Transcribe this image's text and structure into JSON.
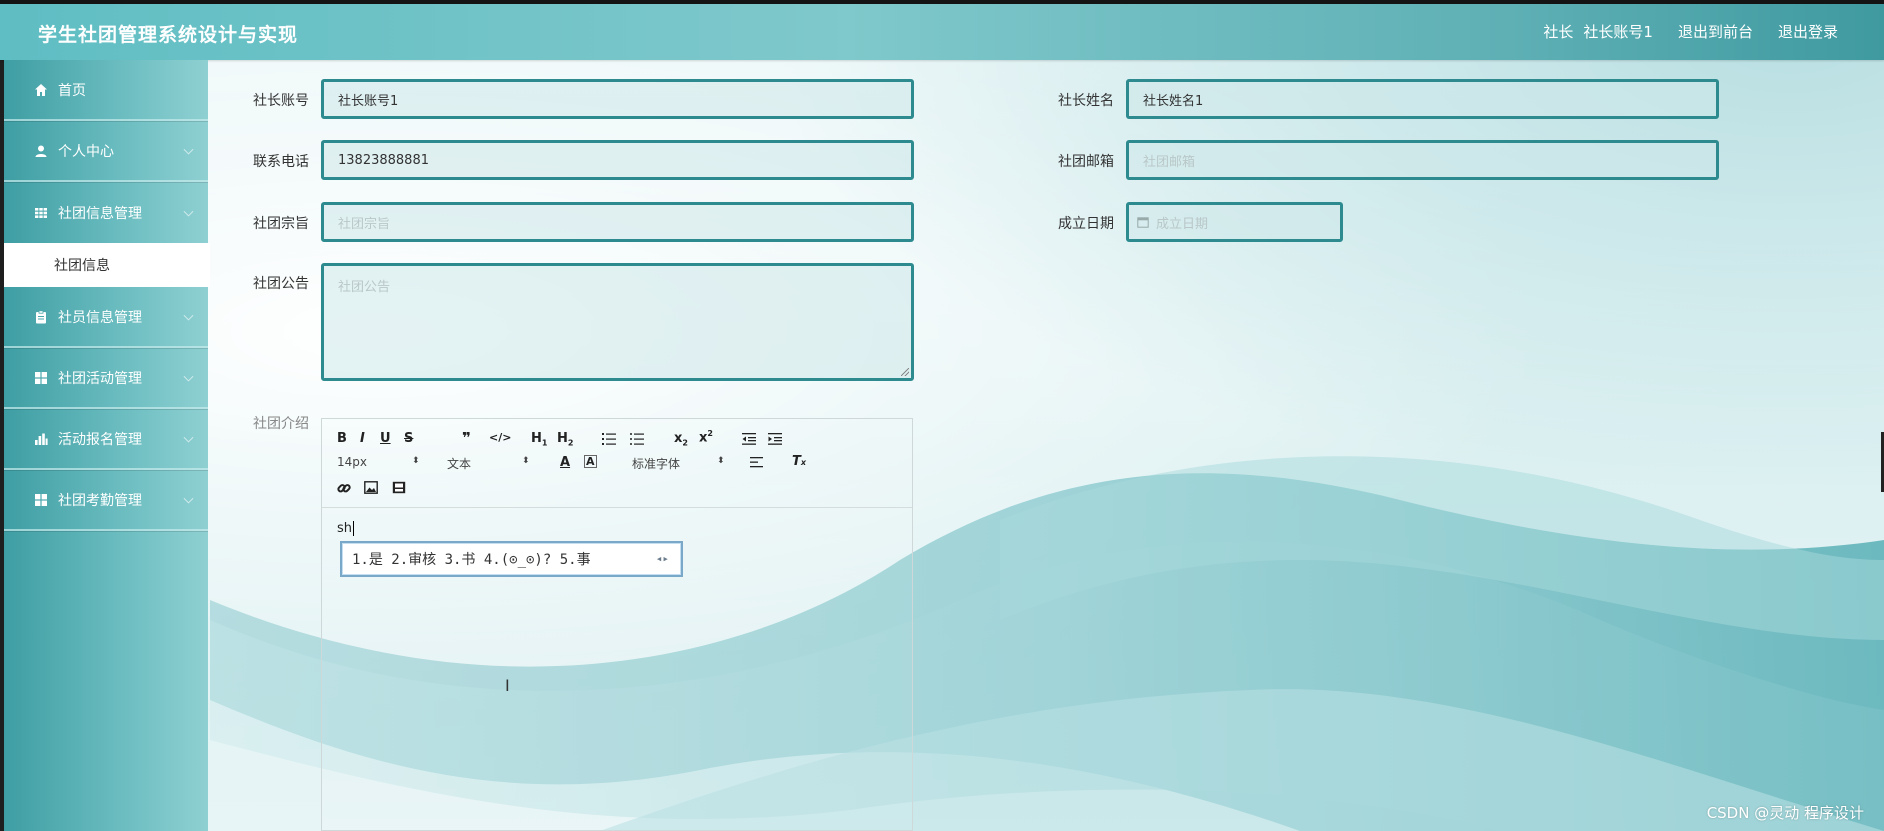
{
  "app": {
    "title": "学生社团管理系统设计与实现",
    "user_role": "社长",
    "user_account": "社长账号1",
    "to_front_label": "退出到前台",
    "logout_label": "退出登录"
  },
  "sidebar": {
    "items": [
      {
        "label": "首页",
        "icon": "home-icon"
      },
      {
        "label": "个人中心",
        "icon": "user-icon"
      },
      {
        "label": "社团信息管理",
        "icon": "grid-icon"
      },
      {
        "label": "社员信息管理",
        "icon": "clipboard-icon"
      },
      {
        "label": "社团活动管理",
        "icon": "grid-icon"
      },
      {
        "label": "活动报名管理",
        "icon": "bar-chart-icon"
      },
      {
        "label": "社团考勤管理",
        "icon": "grid-icon"
      }
    ],
    "active_sub": "社团信息"
  },
  "form": {
    "leader_account": {
      "label": "社长账号",
      "value": "社长账号1"
    },
    "leader_name": {
      "label": "社长姓名",
      "value": "社长姓名1"
    },
    "phone": {
      "label": "联系电话",
      "value": "13823888881"
    },
    "email": {
      "label": "社团邮箱",
      "placeholder": "社团邮箱"
    },
    "purpose": {
      "label": "社团宗旨",
      "placeholder": "社团宗旨"
    },
    "founded": {
      "label": "成立日期",
      "placeholder": "成立日期"
    },
    "notice": {
      "label": "社团公告",
      "placeholder": "社团公告"
    },
    "intro": {
      "label": "社团介绍",
      "typed_text": "sh"
    }
  },
  "editor": {
    "font_size": "14px",
    "paragraph": "文本",
    "font_family": "标准字体"
  },
  "ime": {
    "candidates": "1.是 2.审核 3.书 4.(⊙_⊙)? 5.事"
  },
  "watermark": "CSDN @灵动 程序设计"
}
